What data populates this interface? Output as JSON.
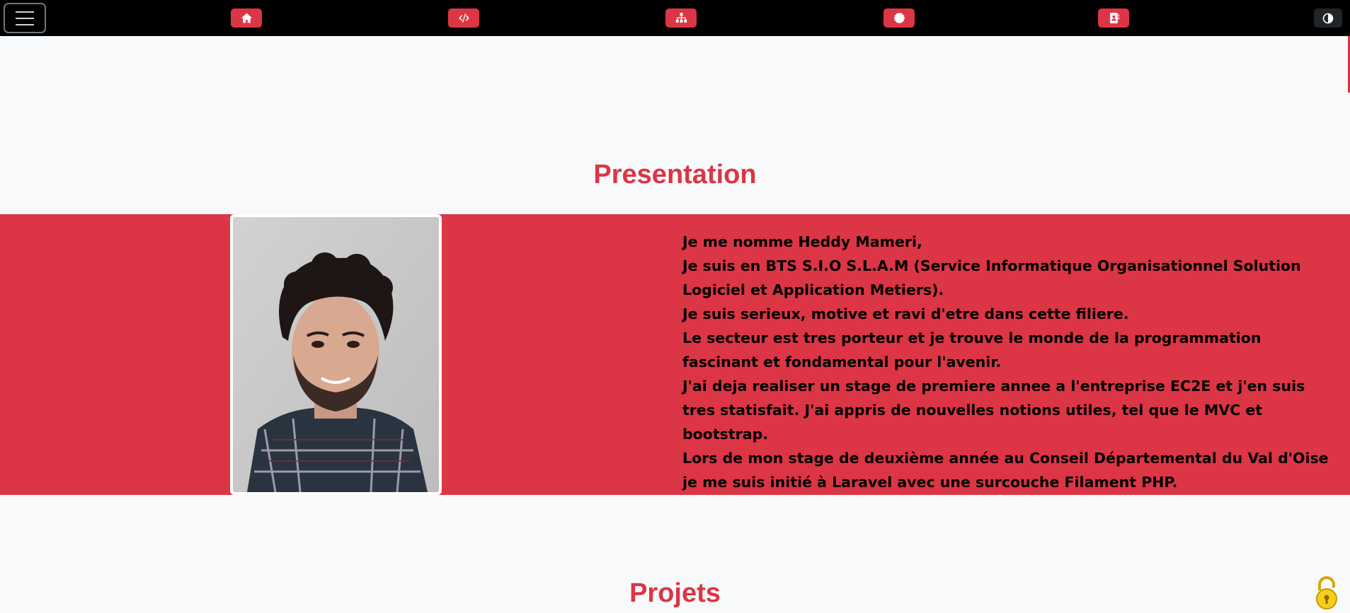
{
  "navbar": {
    "items": [
      {
        "icon": "home-icon"
      },
      {
        "icon": "code-icon"
      },
      {
        "icon": "sitemap-icon"
      },
      {
        "icon": "certificate-icon"
      },
      {
        "icon": "contact-card-icon"
      }
    ],
    "theme_toggle_icon": "contrast-icon",
    "accent_color": "#dc3545"
  },
  "presentation": {
    "title": "Presentation",
    "bio_lines": [
      "Je me nomme Heddy Mameri,",
      "Je suis en BTS S.I.O S.L.A.M (Service Informatique Organisationnel Solution Logiciel et Application Metiers).",
      "Je suis serieux, motive et ravi d'etre dans cette filiere.",
      "Le secteur est tres porteur et je trouve le monde de la programmation fascinant et fondamental pour l'avenir.",
      "J'ai deja realiser un stage de premiere annee a l'entreprise EC2E et j'en suis tres statisfait. J'ai appris de nouvelles notions utiles, tel que le MVC et bootstrap.",
      "Lors de mon stage de deuxième année au Conseil Départemental du Val d'Oise je me suis initié à Laravel avec une surcouche Filament PHP."
    ]
  },
  "projets": {
    "title": "Projets"
  }
}
